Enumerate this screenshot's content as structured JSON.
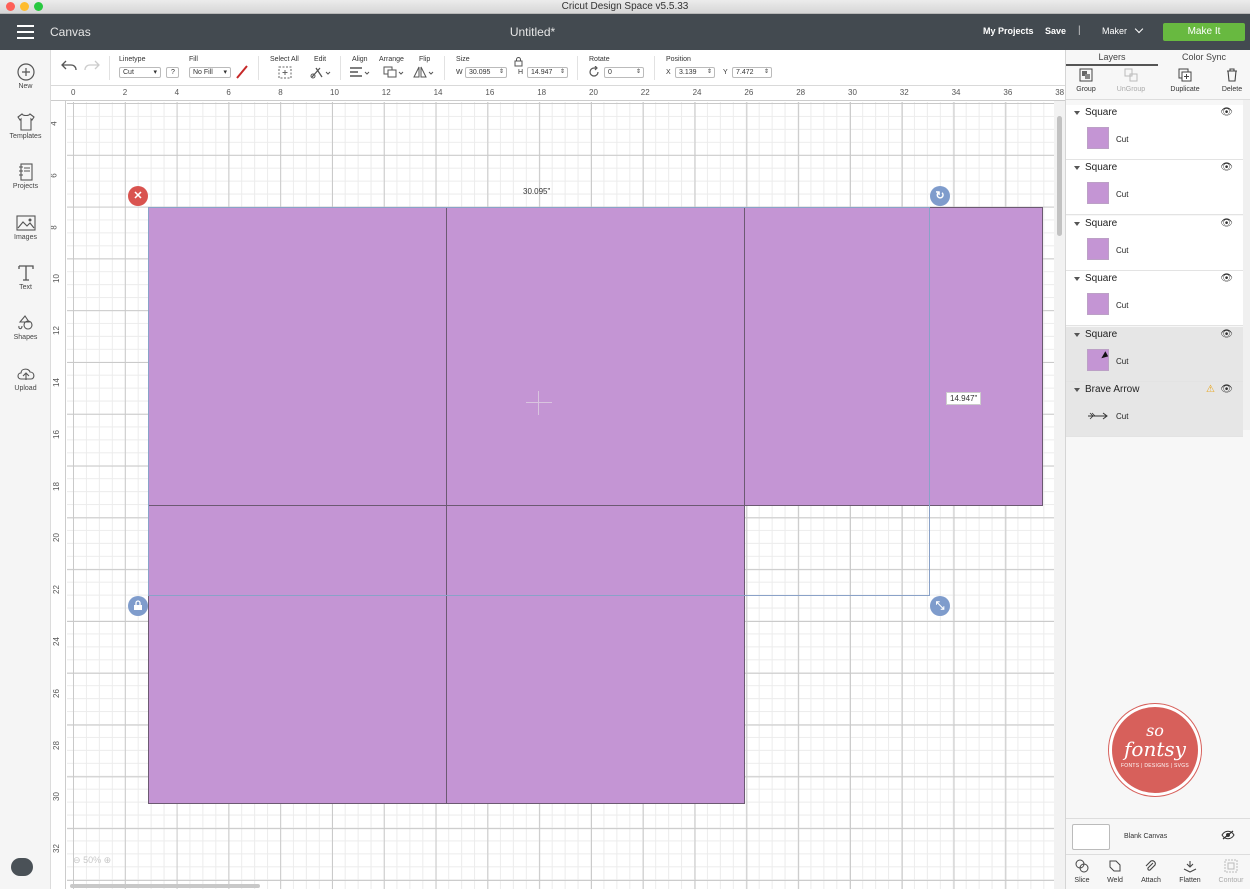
{
  "window": {
    "title": "Cricut Design Space  v5.5.33"
  },
  "appbar": {
    "section": "Canvas",
    "document_title": "Untitled*",
    "my_projects": "My Projects",
    "save": "Save",
    "separator": "|",
    "machine": "Maker",
    "make_it": "Make It"
  },
  "toolbar": {
    "linetype_label": "Linetype",
    "linetype_value": "Cut",
    "linetype_help": "?",
    "fill_label": "Fill",
    "fill_value": "No Fill",
    "select_all_label": "Select All",
    "edit_label": "Edit",
    "align_label": "Align",
    "arrange_label": "Arrange",
    "flip_label": "Flip",
    "size_label": "Size",
    "w_label": "W",
    "w_value": "30.095",
    "h_label": "H",
    "h_value": "14.947",
    "rotate_label": "Rotate",
    "rotate_value": "0",
    "position_label": "Position",
    "x_label": "X",
    "x_value": "3.139",
    "y_label": "Y",
    "y_value": "7.472"
  },
  "left_nav": [
    {
      "label": "New",
      "icon": "plus-circle-icon"
    },
    {
      "label": "Templates",
      "icon": "tshirt-icon"
    },
    {
      "label": "Projects",
      "icon": "notebook-icon"
    },
    {
      "label": "Images",
      "icon": "image-icon"
    },
    {
      "label": "Text",
      "icon": "text-icon"
    },
    {
      "label": "Shapes",
      "icon": "shapes-icon"
    },
    {
      "label": "Upload",
      "icon": "upload-cloud-icon"
    }
  ],
  "rulers": {
    "top": [
      "0",
      "2",
      "4",
      "6",
      "8",
      "10",
      "12",
      "14",
      "16",
      "18",
      "20",
      "22",
      "24",
      "26",
      "28",
      "30",
      "32",
      "34",
      "36",
      "38"
    ],
    "left": [
      "4",
      "6",
      "8",
      "10",
      "12",
      "14",
      "16",
      "18",
      "20",
      "22",
      "24",
      "26",
      "28",
      "30",
      "32"
    ]
  },
  "canvas": {
    "width_dimension": "30.095\"",
    "height_dimension": "14.947\"",
    "zoom": "50%",
    "shape_color": "#c495d4"
  },
  "layers_panel": {
    "tabs": [
      "Layers",
      "Color Sync"
    ],
    "actions": [
      "Group",
      "UnGroup",
      "Duplicate",
      "Delete"
    ],
    "layers": [
      {
        "name": "Square",
        "operation": "Cut"
      },
      {
        "name": "Square",
        "operation": "Cut"
      },
      {
        "name": "Square",
        "operation": "Cut"
      },
      {
        "name": "Square",
        "operation": "Cut"
      },
      {
        "name": "Square",
        "operation": "Cut"
      },
      {
        "name": "Brave Arrow",
        "operation": "Cut"
      }
    ],
    "blank_canvas": "Blank Canvas",
    "bottom_actions": [
      "Slice",
      "Weld",
      "Attach",
      "Flatten",
      "Contour"
    ]
  },
  "logo": {
    "line1": "so",
    "line2": "fontsy",
    "line3": "FONTS | DESIGNS | SVGS"
  }
}
